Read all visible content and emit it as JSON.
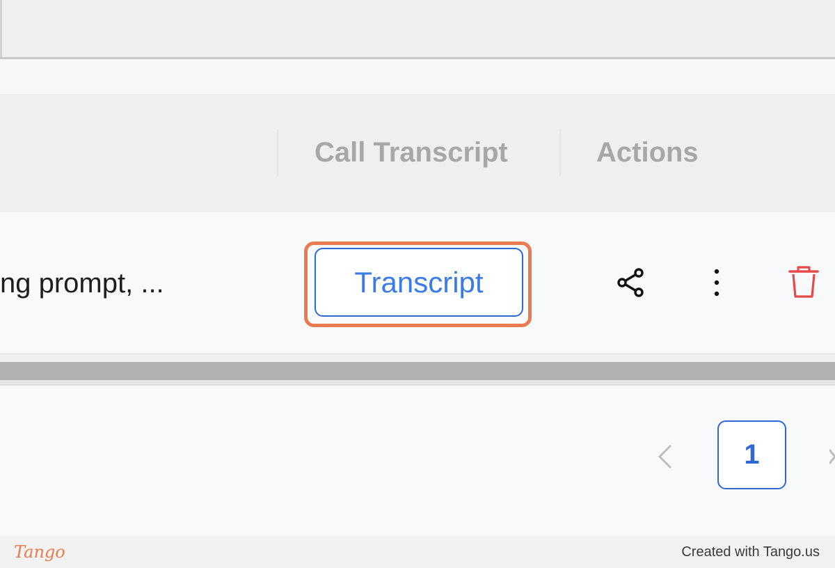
{
  "table": {
    "columns": [
      {
        "label": ""
      },
      {
        "label": "Call Transcript"
      },
      {
        "label": "Actions"
      }
    ],
    "rows": [
      {
        "summary": "ng prompt, ...",
        "transcript_button": "Transcript",
        "actions": {
          "share_icon": "share-icon",
          "more_icon": "more-vertical-icon",
          "delete_icon": "trash-icon"
        }
      }
    ]
  },
  "pagination": {
    "current_page": "1"
  },
  "footer": {
    "logo": "Tango",
    "credit": "Created with Tango.us"
  },
  "colors": {
    "highlight": "#e87b4f",
    "primary": "#2f66d8",
    "delete": "#e54a4a",
    "header_text": "#a7a7a7"
  }
}
